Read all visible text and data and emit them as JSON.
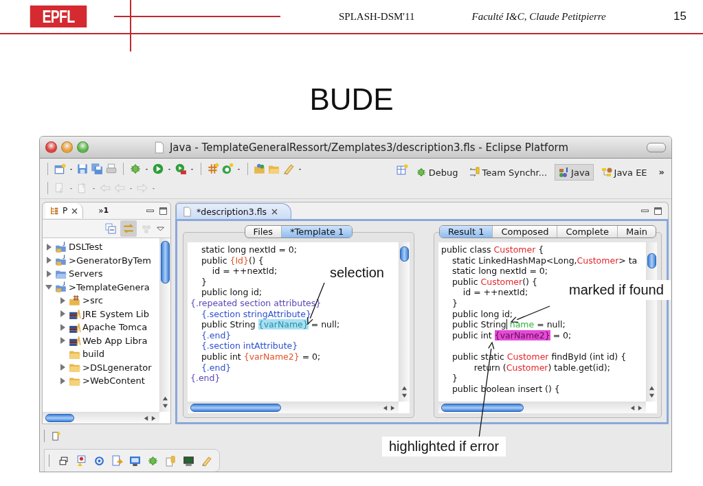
{
  "slide": {
    "logo": "EPFL",
    "conference": "SPLASH-DSM'11",
    "author": "Faculté I&C, Claude Petitpierre",
    "page_number": "15",
    "title": "BUDE"
  },
  "window": {
    "title": "Java - TemplateGeneralRessort/Zemplates3/description3.fls - Eclipse Platform",
    "perspective_overflow": "»",
    "perspectives": [
      {
        "label": "Debug",
        "kind": "debug",
        "selected": false
      },
      {
        "label": "Team Synchr...",
        "kind": "team",
        "selected": false
      },
      {
        "label": "Java",
        "kind": "java",
        "selected": true
      },
      {
        "label": "Java EE",
        "kind": "javaee",
        "selected": false
      }
    ]
  },
  "explorer": {
    "tab": {
      "label": "P",
      "selected": true
    },
    "overflow": "»",
    "overflow_count": "1",
    "tree": [
      {
        "label": "DSLTest",
        "kind": "project",
        "expanded": false
      },
      {
        "label": ">GeneratorByTem",
        "kind": "project",
        "expanded": false
      },
      {
        "label": "Servers",
        "kind": "servers",
        "expanded": false
      },
      {
        "label": ">TemplateGenera",
        "kind": "project",
        "expanded": true,
        "children": [
          {
            "label": ">src",
            "kind": "package",
            "expanded": false
          },
          {
            "label": "JRE System Lib",
            "kind": "library",
            "expanded": false
          },
          {
            "label": "Apache Tomca",
            "kind": "library",
            "expanded": false
          },
          {
            "label": "Web App Libra",
            "kind": "library",
            "expanded": false
          },
          {
            "label": "build",
            "kind": "folder"
          },
          {
            "label": ">DSLgenerator",
            "kind": "folder",
            "expanded": false
          },
          {
            "label": ">WebContent",
            "kind": "folder",
            "expanded": false
          }
        ]
      }
    ]
  },
  "editor": {
    "tab": {
      "label": "*description3.fls",
      "selected": true
    },
    "template_pane": {
      "tabs": [
        {
          "label": "Files",
          "selected": false
        },
        {
          "label": "*Template 1",
          "selected": true
        }
      ],
      "lines": [
        {
          "kind": "code",
          "segments": [
            {
              "text": "    static long nextId = 0;",
              "kind": "plain"
            }
          ]
        },
        {
          "kind": "code",
          "segments": [
            {
              "text": "    public ",
              "kind": "plain"
            },
            {
              "text": "{Id}",
              "kind": "variable"
            },
            {
              "text": "() {",
              "kind": "plain"
            }
          ]
        },
        {
          "kind": "code",
          "segments": [
            {
              "text": "        id = ++nextId;",
              "kind": "plain"
            }
          ]
        },
        {
          "kind": "code",
          "segments": [
            {
              "text": "    }",
              "kind": "plain"
            }
          ]
        },
        {
          "kind": "code",
          "segments": [
            {
              "text": "    public long id;",
              "kind": "plain"
            }
          ]
        },
        {
          "kind": "code",
          "segments": [
            {
              "text": "{.repeated section attributes}",
              "kind": "block"
            }
          ]
        },
        {
          "kind": "code",
          "segments": [
            {
              "text": "    {.section stringAttribute}",
              "kind": "directive"
            }
          ]
        },
        {
          "kind": "code",
          "segments": [
            {
              "text": "    public String ",
              "kind": "plain"
            },
            {
              "text": "{varName}",
              "kind": "selected"
            },
            {
              "text": " = null;",
              "kind": "plain"
            }
          ]
        },
        {
          "kind": "code",
          "segments": [
            {
              "text": "    {.end}",
              "kind": "directive"
            }
          ]
        },
        {
          "kind": "code",
          "segments": [
            {
              "text": "    {.section intAttribute}",
              "kind": "directive"
            }
          ]
        },
        {
          "kind": "code",
          "segments": [
            {
              "text": "    public int ",
              "kind": "plain"
            },
            {
              "text": "{varName2}",
              "kind": "variable"
            },
            {
              "text": " = 0;",
              "kind": "plain"
            }
          ]
        },
        {
          "kind": "code",
          "segments": [
            {
              "text": "    {.end}",
              "kind": "directive"
            }
          ]
        },
        {
          "kind": "code",
          "segments": [
            {
              "text": "{.end}",
              "kind": "block"
            }
          ]
        }
      ]
    },
    "result_pane": {
      "tabs": [
        {
          "label": "Result 1",
          "selected": true
        },
        {
          "label": "Composed",
          "selected": false
        },
        {
          "label": "Complete",
          "selected": false
        },
        {
          "label": "Main",
          "selected": false
        }
      ],
      "lines": [
        {
          "kind": "code",
          "segments": [
            {
              "text": "public class ",
              "kind": "plain"
            },
            {
              "text": "Customer",
              "kind": "type"
            },
            {
              "text": " {",
              "kind": "plain"
            }
          ]
        },
        {
          "kind": "code",
          "segments": [
            {
              "text": "    static LinkedHashMap<Long,",
              "kind": "plain"
            },
            {
              "text": "Customer",
              "kind": "type"
            },
            {
              "text": "> ta",
              "kind": "plain"
            }
          ]
        },
        {
          "kind": "code",
          "segments": [
            {
              "text": "    static long nextId = 0;",
              "kind": "plain"
            }
          ]
        },
        {
          "kind": "code",
          "segments": [
            {
              "text": "    public ",
              "kind": "plain"
            },
            {
              "text": "Customer",
              "kind": "type"
            },
            {
              "text": "() {",
              "kind": "plain"
            }
          ]
        },
        {
          "kind": "code",
          "segments": [
            {
              "text": "        id = ++nextId;",
              "kind": "plain"
            }
          ]
        },
        {
          "kind": "code",
          "segments": [
            {
              "text": "    }",
              "kind": "plain"
            }
          ]
        },
        {
          "kind": "code",
          "segments": [
            {
              "text": "    public long id;",
              "kind": "plain"
            }
          ]
        },
        {
          "kind": "code",
          "segments": [
            {
              "text": "    public String",
              "kind": "plain",
              "caret": true
            },
            {
              "text": " name",
              "kind": "found"
            },
            {
              "text": " = null;",
              "kind": "plain"
            }
          ]
        },
        {
          "kind": "code",
          "segments": [
            {
              "text": "    public int ",
              "kind": "plain"
            },
            {
              "text": "{varName2}",
              "kind": "error"
            },
            {
              "text": " = 0;",
              "kind": "plain"
            }
          ]
        },
        {
          "kind": "blank"
        },
        {
          "kind": "code",
          "segments": [
            {
              "text": "    public static ",
              "kind": "plain"
            },
            {
              "text": "Customer",
              "kind": "type"
            },
            {
              "text": " findById (int id) {",
              "kind": "plain"
            }
          ]
        },
        {
          "kind": "code",
          "segments": [
            {
              "text": "            return (",
              "kind": "plain"
            },
            {
              "text": "Customer",
              "kind": "type"
            },
            {
              "text": ") table.get(id);",
              "kind": "plain"
            }
          ]
        },
        {
          "kind": "code",
          "segments": [
            {
              "text": "    }",
              "kind": "plain"
            }
          ]
        },
        {
          "kind": "code",
          "segments": [
            {
              "text": "    public boolean insert () {",
              "kind": "plain"
            }
          ]
        }
      ]
    }
  },
  "annotations": [
    {
      "text": "selection",
      "boxed": false
    },
    {
      "text": "marked if found",
      "boxed": true
    },
    {
      "text": "highlighted if error",
      "boxed": true
    }
  ]
}
